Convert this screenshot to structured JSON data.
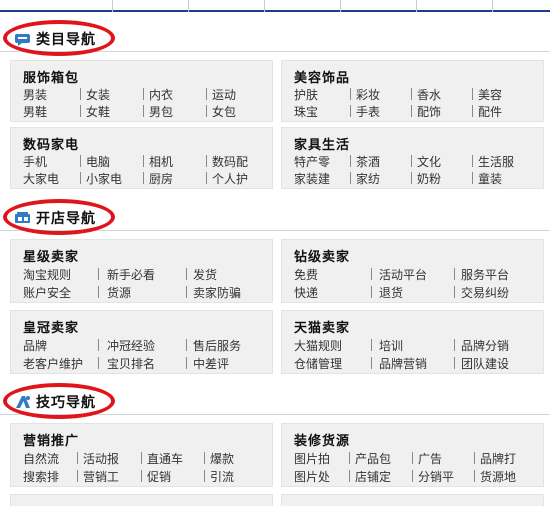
{
  "sections": [
    {
      "title": "类目导航",
      "icon": "bubble-icon",
      "boxes": [
        {
          "title": "服饰箱包",
          "rows": [
            [
              "男装",
              "女装",
              "内衣",
              "运动"
            ],
            [
              "男鞋",
              "女鞋",
              "男包",
              "女包"
            ]
          ]
        },
        {
          "title": "美容饰品",
          "rows": [
            [
              "护肤",
              "彩妆",
              "香水",
              "美容"
            ],
            [
              "珠宝",
              "手表",
              "配饰",
              "配件"
            ]
          ]
        },
        {
          "title": "数码家电",
          "rows": [
            [
              "手机",
              "电脑",
              "相机",
              "数码配"
            ],
            [
              "大家电",
              "小家电",
              "厨房",
              "个人护"
            ]
          ]
        },
        {
          "title": "家具生活",
          "rows": [
            [
              "特产零",
              "茶酒",
              "文化",
              "生活服"
            ],
            [
              "家装建",
              "家纺",
              "奶粉",
              "童装"
            ]
          ]
        }
      ]
    },
    {
      "title": "开店导航",
      "icon": "shop-icon",
      "boxes": [
        {
          "title": "星级卖家",
          "rows": [
            [
              "淘宝规则",
              "新手必看",
              "发货"
            ],
            [
              "账户安全",
              "货源",
              "卖家防骗"
            ]
          ]
        },
        {
          "title": "钻级卖家",
          "rows": [
            [
              "免费",
              "活动平台",
              "服务平台"
            ],
            [
              "快递",
              "退货",
              "交易纠纷"
            ]
          ]
        },
        {
          "title": "皇冠卖家",
          "rows": [
            [
              "品牌",
              "冲冠经验",
              "售后服务"
            ],
            [
              "老客户维护",
              "宝贝排名",
              "中差评"
            ]
          ]
        },
        {
          "title": "天猫卖家",
          "rows": [
            [
              "大猫规则",
              "培训",
              "品牌分销"
            ],
            [
              "仓储管理",
              "品牌营销",
              "团队建设"
            ]
          ]
        }
      ]
    },
    {
      "title": "技巧导航",
      "icon": "tools-icon",
      "boxes": [
        {
          "title": "营销推广",
          "rows": [
            [
              "自然流",
              "活动报",
              "直通车",
              "爆款"
            ],
            [
              "搜索排",
              "营销工",
              "促销",
              "引流"
            ]
          ]
        },
        {
          "title": "装修货源",
          "rows": [
            [
              "图片拍",
              "产品包",
              "广告",
              "品牌打"
            ],
            [
              "图片处",
              "店铺定",
              "分销平",
              "货源地"
            ]
          ]
        }
      ]
    }
  ],
  "colors": {
    "highlight_ring": "#e0151b",
    "box_bg": "#f0f0f0",
    "top_rule": "#1d3f8a"
  }
}
